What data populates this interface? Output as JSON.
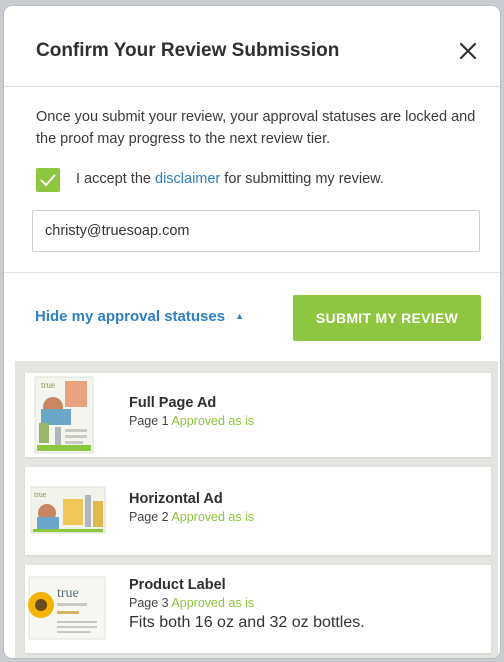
{
  "dialog": {
    "title": "Confirm Your Review Submission",
    "intro": "Once you submit your review, your approval statuses are locked and the proof may progress to the next review tier.",
    "disclaimer": {
      "prefix": "I accept the ",
      "link": "disclaimer",
      "suffix": " for submitting my review.",
      "checked": true
    },
    "email_value": "christy@truesoap.com",
    "toggle_label": "Hide my approval statuses",
    "submit_label": "SUBMIT MY REVIEW"
  },
  "items": [
    {
      "title": "Full Page Ad",
      "page": "Page 1",
      "status": "Approved as is",
      "note": "",
      "thumb_text": "true"
    },
    {
      "title": "Horizontal Ad",
      "page": "Page 2",
      "status": "Approved as is",
      "note": "",
      "thumb_text": "true"
    },
    {
      "title": "Product Label",
      "page": "Page 3",
      "status": "Approved as is",
      "note": "Fits both 16 oz and 32 oz bottles.",
      "thumb_text": "true"
    }
  ],
  "colors": {
    "accent_green": "#8dc63f",
    "link_blue": "#2f7fc1",
    "background": "#c9cdd2"
  },
  "icons": {
    "close": "close-icon",
    "check": "checkmark-icon",
    "caret": "caret-up-icon"
  }
}
